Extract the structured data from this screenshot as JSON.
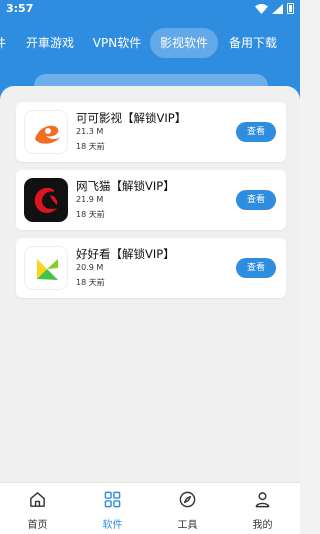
{
  "status_bar": {
    "time": "3:57"
  },
  "tabs": [
    {
      "label": "件",
      "active": false
    },
    {
      "label": "开車游戏",
      "active": false
    },
    {
      "label": "VPN软件",
      "active": false
    },
    {
      "label": "影视软件",
      "active": true
    },
    {
      "label": "备用下载",
      "active": false
    }
  ],
  "apps": [
    {
      "name": "可可影视【解锁VIP】",
      "size": "21.3 M",
      "date": "18 天前",
      "button": "查看",
      "icon": "kekeyingshi-logo-icon"
    },
    {
      "name": "网飞猫【解锁VIP】",
      "size": "21.9 M",
      "date": "18 天前",
      "button": "查看",
      "icon": "wangfeimao-logo-icon"
    },
    {
      "name": "好好看【解锁VIP】",
      "size": "20.9 M",
      "date": "18 天前",
      "button": "查看",
      "icon": "haohaokan-logo-icon"
    }
  ],
  "bottom_nav": [
    {
      "label": "首页",
      "icon": "home-icon",
      "active": false
    },
    {
      "label": "软件",
      "icon": "apps-grid-icon",
      "active": true
    },
    {
      "label": "工具",
      "icon": "compass-icon",
      "active": false
    },
    {
      "label": "我的",
      "icon": "user-icon",
      "active": false
    }
  ],
  "colors": {
    "accent": "#2f8de0",
    "background": "#f0f0f0",
    "card": "#ffffff"
  }
}
